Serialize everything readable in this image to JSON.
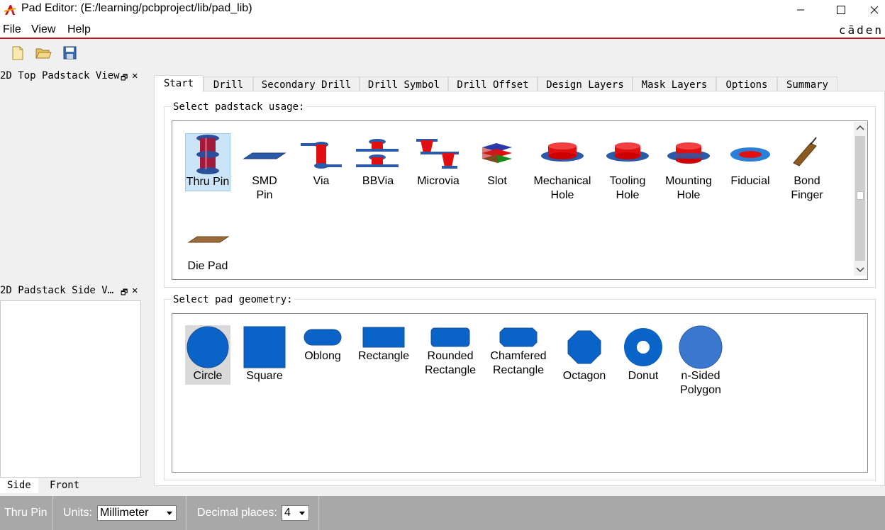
{
  "window": {
    "title": "Pad Editor:  (E:/learning/pcbproject/lib/pad_lib)"
  },
  "menu": {
    "items": [
      "File",
      "View",
      "Help"
    ],
    "brand": "cāden"
  },
  "toolbar": {
    "icons": [
      "new-file-icon",
      "open-folder-icon",
      "save-icon"
    ]
  },
  "docks": {
    "top_view_title": "2D Top Padstack View",
    "side_view_title": "2D Padstack Side V…",
    "side_tabs": [
      "Side",
      "Front"
    ]
  },
  "tabs": [
    "Start",
    "Drill",
    "Secondary Drill",
    "Drill Symbol",
    "Drill Offset",
    "Design Layers",
    "Mask Layers",
    "Options",
    "Summary"
  ],
  "usage": {
    "label": "Select padstack usage:",
    "items": [
      [
        "Thru Pin",
        ""
      ],
      [
        "SMD",
        "Pin"
      ],
      [
        "Via",
        ""
      ],
      [
        "BBVia",
        ""
      ],
      [
        "Microvia",
        ""
      ],
      [
        "Slot",
        ""
      ],
      [
        "Mechanical",
        "Hole"
      ],
      [
        "Tooling",
        "Hole"
      ],
      [
        "Mounting",
        "Hole"
      ],
      [
        "Fiducial",
        ""
      ],
      [
        "Bond",
        "Finger"
      ],
      [
        "Die Pad",
        ""
      ]
    ],
    "selected": "Thru Pin"
  },
  "geometry": {
    "label": "Select pad geometry:",
    "items": [
      [
        "Circle",
        ""
      ],
      [
        "Square",
        ""
      ],
      [
        "Oblong",
        ""
      ],
      [
        "Rectangle",
        ""
      ],
      [
        "Rounded",
        "Rectangle"
      ],
      [
        "Chamfered",
        "Rectangle"
      ],
      [
        "Octagon",
        ""
      ],
      [
        "Donut",
        ""
      ],
      [
        "n-Sided",
        "Polygon"
      ]
    ],
    "selected": "Circle"
  },
  "status": {
    "usage": "Thru Pin",
    "units_label": "Units:",
    "units_value": "Millimeter",
    "decimal_label": "Decimal places:",
    "decimal_value": "4"
  },
  "colors": {
    "accent": "#c8141e",
    "pad_blue": "#0a64c8",
    "status_bg": "#a8a8a8"
  }
}
